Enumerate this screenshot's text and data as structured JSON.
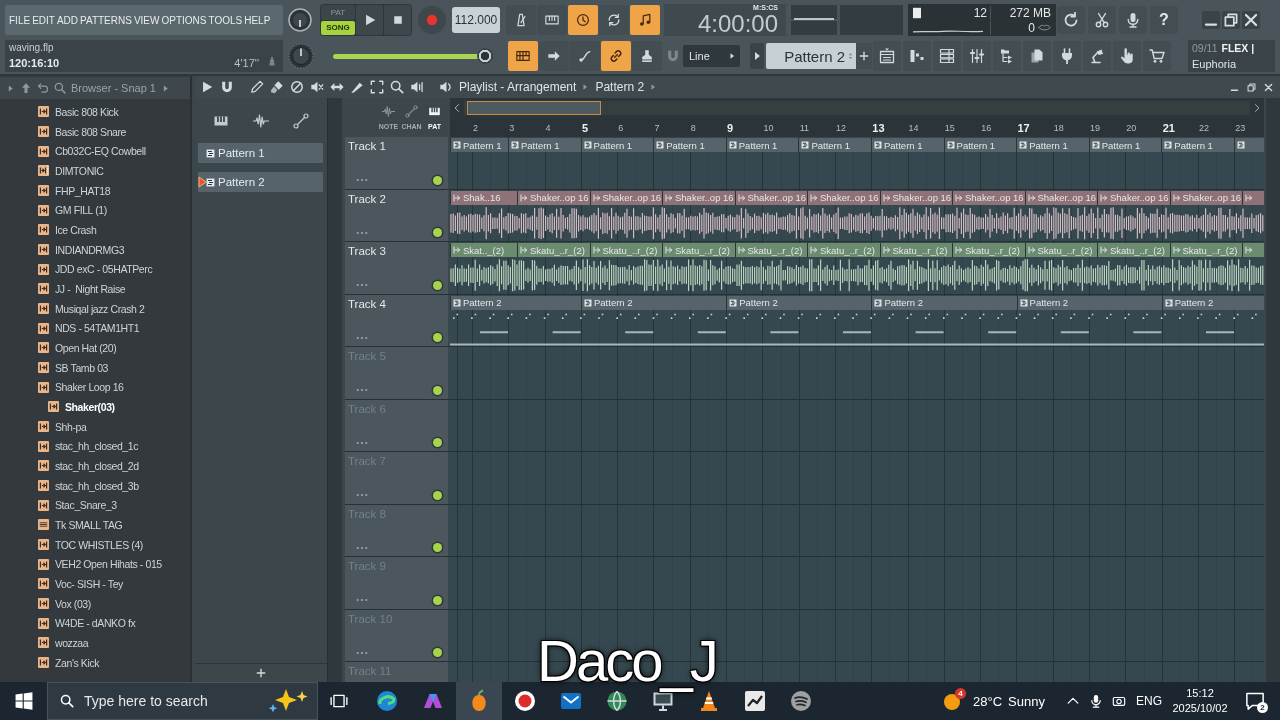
{
  "menu": [
    "FILE",
    "EDIT",
    "ADD",
    "PATTERNS",
    "VIEW",
    "OPTIONS",
    "TOOLS",
    "HELP"
  ],
  "song": {
    "file": "waving.flp",
    "position": "120:16:10",
    "length": "4'17''"
  },
  "transport": {
    "modes": [
      {
        "label": "PAT",
        "selected": false
      },
      {
        "label": "SONG",
        "selected": true
      }
    ],
    "tempo": "112.000"
  },
  "record_tools": [
    {
      "on": false
    },
    {
      "on": false
    },
    {
      "on": true
    },
    {
      "on": false
    },
    {
      "on": true
    }
  ],
  "clock": {
    "time": "4:00:00",
    "format": "M:S:CS"
  },
  "monitor": {
    "voices": "12",
    "memory": "272 MB",
    "cpu": "0"
  },
  "help_button": "?",
  "master_volume": {
    "level": 0.95
  },
  "view_tools": [
    {
      "on": true
    },
    {
      "on": false
    },
    {
      "on": false
    },
    {
      "on": true
    },
    {
      "on": false
    }
  ],
  "snap": {
    "value": "Line"
  },
  "pattern_selector": {
    "value": "Pattern 2"
  },
  "news": {
    "date": "09/11",
    "title": "FLEX |",
    "subtitle": "Euphoria"
  },
  "browser": {
    "title": "Browser - Snap 1",
    "items": [
      {
        "label": "Basic 808 Kick",
        "kind": "audio",
        "selected": false
      },
      {
        "label": "Basic 808 Snare",
        "kind": "audio",
        "selected": false
      },
      {
        "label": "Cb032C-EQ Cowbell",
        "kind": "audio",
        "selected": false
      },
      {
        "label": "DIMTONIC",
        "kind": "tagged",
        "selected": false
      },
      {
        "label": "FHP_HAT18",
        "kind": "audio",
        "selected": false
      },
      {
        "label": "GM FILL (1)",
        "kind": "audio",
        "selected": false
      },
      {
        "label": "Ice Crash",
        "kind": "audio",
        "selected": false
      },
      {
        "label": "INDIANDRMG3",
        "kind": "audio",
        "selected": false
      },
      {
        "label": "JDD exC - 05HATPerc",
        "kind": "audio",
        "selected": false
      },
      {
        "label": "JJ -  Night Raise",
        "kind": "audio",
        "selected": false
      },
      {
        "label": "Musiqal jazz Crash 2",
        "kind": "audio",
        "selected": false
      },
      {
        "label": "NDS - 54TAM1HT1",
        "kind": "audio",
        "selected": false
      },
      {
        "label": "Open Hat (20)",
        "kind": "audio",
        "selected": false
      },
      {
        "label": "SB Tamb 03",
        "kind": "audio",
        "selected": false
      },
      {
        "label": "Shaker Loop 16",
        "kind": "audio",
        "selected": false,
        "children": [
          {
            "label": "Shaker(03)",
            "kind": "audio",
            "selected": true
          }
        ]
      },
      {
        "label": "Shh-pa",
        "kind": "audio",
        "selected": false
      },
      {
        "label": "stac_hh_closed_1c",
        "kind": "audio",
        "selected": false
      },
      {
        "label": "stac_hh_closed_2d",
        "kind": "audio",
        "selected": false
      },
      {
        "label": "stac_hh_closed_3b",
        "kind": "audio",
        "selected": false
      },
      {
        "label": "Stac_Snare_3",
        "kind": "audio",
        "selected": false
      },
      {
        "label": "Tk SMALL TAG",
        "kind": "mp3",
        "selected": false
      },
      {
        "label": "TOC WHISTLES (4)",
        "kind": "audio",
        "selected": false
      },
      {
        "label": "VEH2 Open Hihats - 015",
        "kind": "audio",
        "selected": false
      },
      {
        "label": "Voc- SISH - Tey",
        "kind": "audio",
        "selected": false
      },
      {
        "label": "Vox (03)",
        "kind": "audio",
        "selected": false
      },
      {
        "label": "W4DE - dANKO fx",
        "kind": "audio",
        "selected": false
      },
      {
        "label": "wozzaa",
        "kind": "audio",
        "selected": false
      },
      {
        "label": "Zan's Kick",
        "kind": "audio",
        "selected": false
      }
    ]
  },
  "patterns": [
    {
      "label": "Pattern 1",
      "selected": false
    },
    {
      "label": "Pattern 2",
      "selected": true
    }
  ],
  "playlist": {
    "title": "Playlist - Arrangement",
    "pattern": "Pattern 2",
    "filters": [
      {
        "label": "NOTE",
        "selected": false
      },
      {
        "label": "CHAN",
        "selected": false
      },
      {
        "label": "PAT",
        "selected": true
      }
    ],
    "ruler": [
      "2",
      "3",
      "4",
      "5",
      "6",
      "7",
      "8",
      "9",
      "10",
      "11",
      "12",
      "13",
      "14",
      "15",
      "16",
      "17",
      "18",
      "19",
      "20",
      "21",
      "22",
      "23"
    ],
    "tracks": [
      {
        "name": "Track 1",
        "kind": "pattern",
        "clips": [
          "Pattern 1",
          "Pattern 1",
          "Pattern 1",
          "Pattern 1",
          "Pattern 1",
          "Pattern 1",
          "Pattern 1",
          "Pattern 1",
          "Pattern 1",
          "Pattern 1",
          "Pattern 1"
        ],
        "more": true
      },
      {
        "name": "Track 2",
        "kind": "audio",
        "color": "#8e7278",
        "clips": [
          "Shak..16",
          "Shaker..op 16",
          "Shaker..op 16",
          "Shaker..op 16",
          "Shaker..op 16",
          "Shaker..op 16",
          "Shaker..op 16",
          "Shaker..op 16",
          "Shaker..op 16",
          "Shaker..op 16",
          "Shaker..op 16"
        ],
        "more": true
      },
      {
        "name": "Track 3",
        "kind": "audio",
        "color": "#6c8c70",
        "clips": [
          "Skat.._(2)",
          "Skatu_..r_(2)",
          "Skatu_..r_(2)",
          "Skatu_..r_(2)",
          "Skatu_..r_(2)",
          "Skatu_..r_(2)",
          "Skatu_..r_(2)",
          "Skatu_..r_(2)",
          "Skatu_..r_(2)",
          "Skatu_..r_(2)",
          "Skatu_..r_(2)"
        ],
        "more": true
      },
      {
        "name": "Track 4",
        "kind": "notes",
        "clips": [
          "Pattern 2",
          "Pattern 2",
          "Pattern 2",
          "Pattern 2",
          "Pattern 2",
          "Pattern 2"
        ],
        "more": false
      },
      {
        "name": "Track 5",
        "kind": "empty",
        "more": false
      },
      {
        "name": "Track 6",
        "kind": "empty",
        "more": false
      },
      {
        "name": "Track 7",
        "kind": "empty",
        "more": false
      },
      {
        "name": "Track 8",
        "kind": "empty",
        "more": false
      },
      {
        "name": "Track 9",
        "kind": "empty",
        "more": false
      },
      {
        "name": "Track 10",
        "kind": "empty",
        "more": false
      },
      {
        "name": "Track 11",
        "kind": "empty",
        "more": false
      }
    ]
  },
  "taskbar": {
    "search": {
      "placeholder": "Type here to search"
    },
    "apps": [
      {
        "selected": false
      },
      {
        "selected": false
      },
      {
        "selected": true
      },
      {
        "selected": false
      },
      {
        "selected": false
      },
      {
        "selected": false
      },
      {
        "selected": false
      },
      {
        "selected": false
      },
      {
        "selected": false
      },
      {
        "selected": false
      }
    ],
    "weather": {
      "badge": "4",
      "temperature": "28°C",
      "condition": "Sunny"
    },
    "language": "ENG",
    "time": "15:12",
    "date": "2025/10/02",
    "notifications": "2"
  },
  "caption": "Daco_J"
}
